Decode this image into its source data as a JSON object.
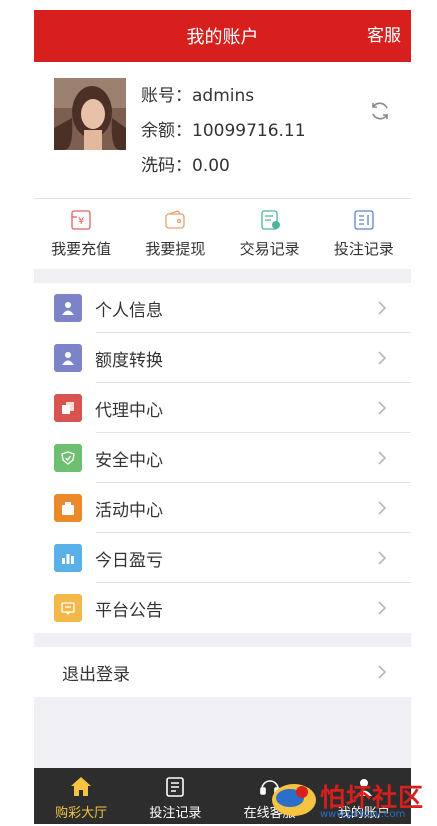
{
  "header": {
    "title": "我的账户",
    "service": "客服"
  },
  "profile": {
    "account_label": "账号：",
    "account_value": "admins",
    "balance_label": "余额：",
    "balance_value": "10099716.11",
    "wash_label": "洗码：",
    "wash_value": "0.00"
  },
  "actions": [
    {
      "label": "我要充值",
      "icon": "recharge-icon"
    },
    {
      "label": "我要提现",
      "icon": "wallet-icon"
    },
    {
      "label": "交易记录",
      "icon": "transaction-icon"
    },
    {
      "label": "投注记录",
      "icon": "bet-record-icon"
    }
  ],
  "menu": [
    {
      "label": "个人信息",
      "icon": "user-icon",
      "color": "#7c83c8"
    },
    {
      "label": "额度转换",
      "icon": "user-icon",
      "color": "#7c83c8"
    },
    {
      "label": "代理中心",
      "icon": "agent-icon",
      "color": "#d9534f"
    },
    {
      "label": "安全中心",
      "icon": "shield-icon",
      "color": "#6cc070"
    },
    {
      "label": "活动中心",
      "icon": "gift-icon",
      "color": "#ea8a2b"
    },
    {
      "label": "今日盈亏",
      "icon": "chart-icon",
      "color": "#5ab0e8"
    },
    {
      "label": "平台公告",
      "icon": "notice-icon",
      "color": "#f2b94a"
    }
  ],
  "logout": {
    "label": "退出登录"
  },
  "tabbar": [
    {
      "label": "购彩大厅",
      "icon": "home-icon",
      "active": true
    },
    {
      "label": "投注记录",
      "icon": "record-icon",
      "active": false
    },
    {
      "label": "在线客服",
      "icon": "support-icon",
      "active": false
    },
    {
      "label": "我的账户",
      "icon": "account-icon",
      "active": false
    }
  ],
  "watermark": {
    "text": "怕坏社区",
    "url": "www.pahuai.com"
  }
}
